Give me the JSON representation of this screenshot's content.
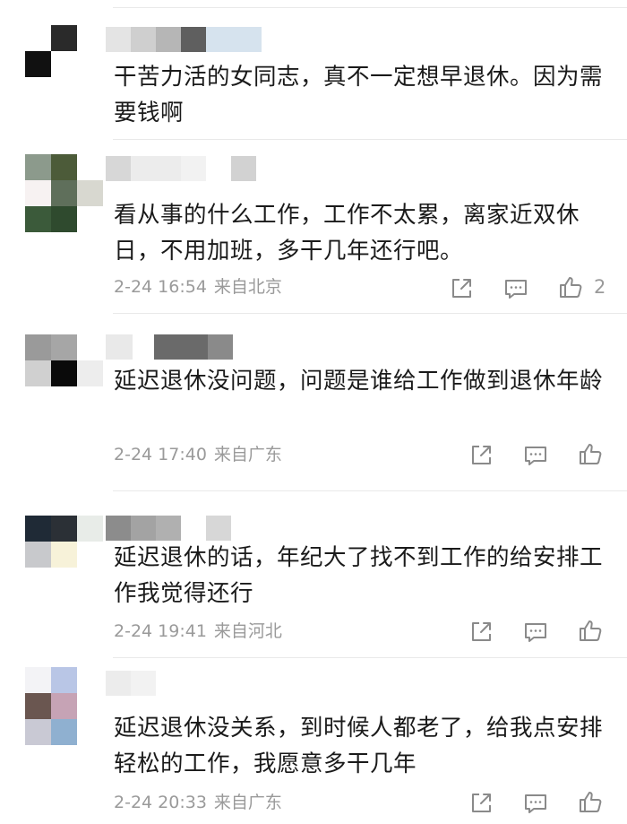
{
  "comments": [
    {
      "text": "干苦力活的女同志，真不一定想早退休。因为需要钱啊",
      "time": "",
      "location": "",
      "likes": "",
      "avatar_colors": [
        "#ffffff",
        "#2a2a2a",
        "#ffffff",
        "#111111",
        "#ffffff",
        "#ffffff",
        "#ffffff",
        "#ffffff",
        "#ffffff"
      ],
      "name_colors": [
        "#e4e4e4",
        "#cfcfcf",
        "#b6b6b6",
        "#5f5f5f",
        "#d6e3ee"
      ]
    },
    {
      "text": "看从事的什么工作，工作不太累，离家近双休日，不用加班，多干几年还行吧。",
      "time": "2-24 16:54",
      "location": "来自北京",
      "likes": "2",
      "avatar_colors": [
        "#8c9a8c",
        "#4c5b39",
        "#ffffff",
        "#f7f2f2",
        "#5f6f5b",
        "#d8d8d0",
        "#3b5a3a",
        "#2f4a2e",
        "#ffffff"
      ],
      "name_colors": [
        "#d7d7d7",
        "#ececec",
        "#f2f2f2",
        "#d2d2d2"
      ]
    },
    {
      "text": "延迟退休没问题，问题是谁给工作做到退休年龄",
      "time": "2-24 17:40",
      "location": "来自广东",
      "likes": "",
      "avatar_colors": [
        "#9a9a9a",
        "#a6a6a6",
        "#ffffff",
        "#d0d0d0",
        "#0a0a0a",
        "#ededed",
        "#ffffff",
        "#ffffff",
        "#ffffff"
      ],
      "name_colors": [
        "#e9e9e9",
        "#6a6a6a",
        "#8a8a8a"
      ]
    },
    {
      "text": "延迟退休的话，年纪大了找不到工作的给安排工作我觉得还行",
      "time": "2-24 19:41",
      "location": "来自河北",
      "likes": "",
      "avatar_colors": [
        "#1f2a36",
        "#2b3036",
        "#e8ece8",
        "#c8c9cc",
        "#f7f2d9",
        "#ffffff",
        "#ffffff",
        "#ffffff",
        "#ffffff"
      ],
      "name_colors": [
        "#8c8c8c",
        "#a3a3a3",
        "#b0b0b0",
        "#d7d7d7"
      ]
    },
    {
      "text": "延迟退休没关系，到时候人都老了，给我点安排轻松的工作，我愿意多干几年",
      "time": "2-24 20:33",
      "location": "来自广东",
      "likes": "",
      "avatar_colors": [
        "#f3f3f6",
        "#b9c6e6",
        "#ffffff",
        "#6a5650",
        "#c6a3b5",
        "#ffffff",
        "#c9c9d4",
        "#8fb0d0",
        "#ffffff"
      ],
      "name_colors": [
        "#ececec",
        "#f2f2f2"
      ]
    }
  ],
  "icons": {
    "share": "share-icon",
    "reply": "comment-icon",
    "like": "like-icon"
  },
  "colors": {
    "text": "#1a1a1a",
    "meta": "#9a9a9a",
    "divider": "#e9e9e9",
    "icon": "#8a8a8a"
  }
}
